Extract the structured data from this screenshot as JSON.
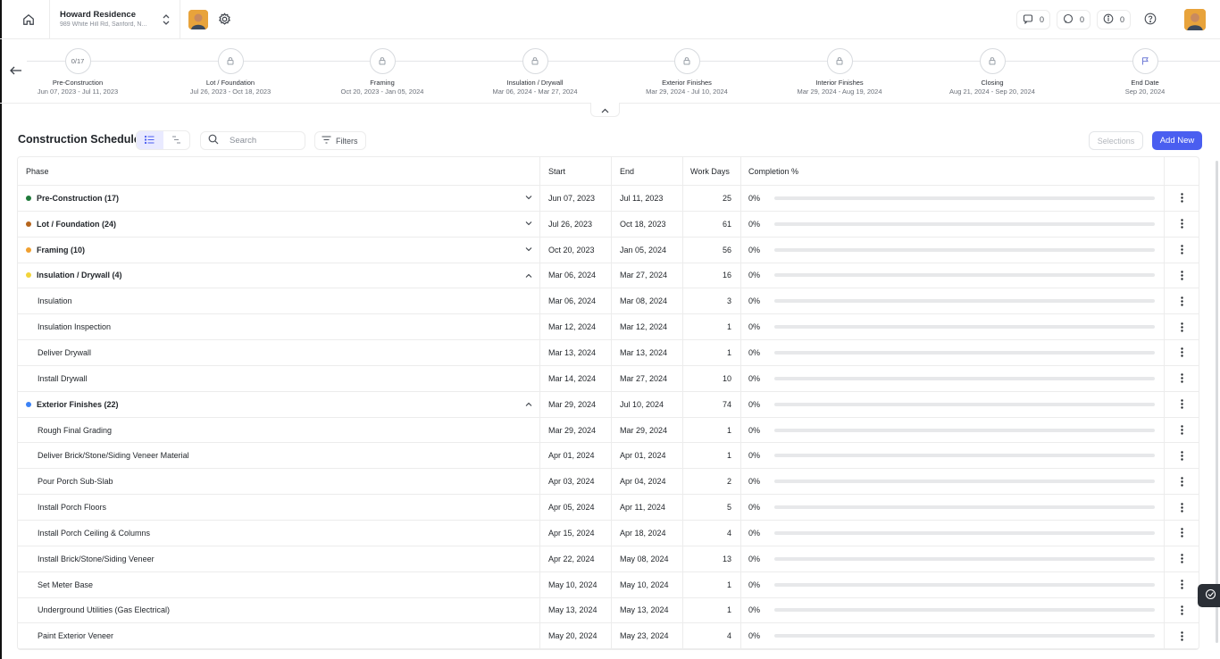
{
  "project": {
    "name": "Howard Residence",
    "address": "989 White Hill Rd, Sanford, N..."
  },
  "header": {
    "messages_count": "0",
    "comments_count": "0",
    "alerts_count": "0"
  },
  "timeline": {
    "steps": [
      {
        "circle": "0/17",
        "name": "Pre-Construction",
        "range": "Jun 07, 2023 - Jul 11, 2023",
        "icon": "progress-text"
      },
      {
        "circle": "",
        "name": "Lot / Foundation",
        "range": "Jul 26, 2023 - Oct 18, 2023",
        "icon": "lock-icon"
      },
      {
        "circle": "",
        "name": "Framing",
        "range": "Oct 20, 2023 - Jan 05, 2024",
        "icon": "lock-icon"
      },
      {
        "circle": "",
        "name": "Insulation / Drywall",
        "range": "Mar 06, 2024 - Mar 27, 2024",
        "icon": "lock-icon"
      },
      {
        "circle": "",
        "name": "Exterior Finishes",
        "range": "Mar 29, 2024 - Jul 10, 2024",
        "icon": "lock-icon"
      },
      {
        "circle": "",
        "name": "Interior Finishes",
        "range": "Mar 29, 2024 - Aug 19, 2024",
        "icon": "lock-icon"
      },
      {
        "circle": "",
        "name": "Closing",
        "range": "Aug 21, 2024 - Sep 20, 2024",
        "icon": "lock-icon"
      },
      {
        "circle": "",
        "name": "End Date",
        "range": "Sep 20, 2024",
        "icon": "flag-icon"
      }
    ]
  },
  "toolbar": {
    "title": "Construction Schedule",
    "search_placeholder": "Search",
    "filters_label": "Filters",
    "selections_label": "Selections",
    "add_new_label": "Add New"
  },
  "table": {
    "columns": {
      "phase": "Phase",
      "start": "Start",
      "end": "End",
      "days": "Work Days",
      "completion": "Completion %"
    },
    "rows": [
      {
        "type": "group",
        "phase": "Pre-Construction (17)",
        "dot": "#1f7a3a",
        "expanded": false,
        "start": "Jun 07, 2023",
        "end": "Jul 11, 2023",
        "days": "25",
        "completion": "0%",
        "progress": 0
      },
      {
        "type": "group",
        "phase": "Lot / Foundation (24)",
        "dot": "#b5651d",
        "expanded": false,
        "start": "Jul 26, 2023",
        "end": "Oct 18, 2023",
        "days": "61",
        "completion": "0%",
        "progress": 0
      },
      {
        "type": "group",
        "phase": "Framing (10)",
        "dot": "#f0a030",
        "expanded": false,
        "start": "Oct 20, 2023",
        "end": "Jan 05, 2024",
        "days": "56",
        "completion": "0%",
        "progress": 0
      },
      {
        "type": "group",
        "phase": "Insulation / Drywall (4)",
        "dot": "#f2d43a",
        "expanded": true,
        "start": "Mar 06, 2024",
        "end": "Mar 27, 2024",
        "days": "16",
        "completion": "0%",
        "progress": 0
      },
      {
        "type": "child",
        "phase": "Insulation",
        "start": "Mar 06, 2024",
        "end": "Mar 08, 2024",
        "days": "3",
        "completion": "0%",
        "progress": 0
      },
      {
        "type": "child",
        "phase": "Insulation Inspection",
        "start": "Mar 12, 2024",
        "end": "Mar 12, 2024",
        "days": "1",
        "completion": "0%",
        "progress": 0
      },
      {
        "type": "child",
        "phase": "Deliver Drywall",
        "start": "Mar 13, 2024",
        "end": "Mar 13, 2024",
        "days": "1",
        "completion": "0%",
        "progress": 0
      },
      {
        "type": "child",
        "phase": "Install Drywall",
        "start": "Mar 14, 2024",
        "end": "Mar 27, 2024",
        "days": "10",
        "completion": "0%",
        "progress": 0
      },
      {
        "type": "group",
        "phase": "Exterior Finishes (22)",
        "dot": "#3b82f6",
        "expanded": true,
        "start": "Mar 29, 2024",
        "end": "Jul 10, 2024",
        "days": "74",
        "completion": "0%",
        "progress": 0
      },
      {
        "type": "child",
        "phase": "Rough Final Grading",
        "start": "Mar 29, 2024",
        "end": "Mar 29, 2024",
        "days": "1",
        "completion": "0%",
        "progress": 0
      },
      {
        "type": "child",
        "phase": "Deliver Brick/Stone/Siding Veneer Material",
        "start": "Apr 01, 2024",
        "end": "Apr 01, 2024",
        "days": "1",
        "completion": "0%",
        "progress": 0
      },
      {
        "type": "child",
        "phase": "Pour Porch Sub-Slab",
        "start": "Apr 03, 2024",
        "end": "Apr 04, 2024",
        "days": "2",
        "completion": "0%",
        "progress": 0
      },
      {
        "type": "child",
        "phase": "Install Porch Floors",
        "start": "Apr 05, 2024",
        "end": "Apr 11, 2024",
        "days": "5",
        "completion": "0%",
        "progress": 0
      },
      {
        "type": "child",
        "phase": "Install Porch Ceiling & Columns",
        "start": "Apr 15, 2024",
        "end": "Apr 18, 2024",
        "days": "4",
        "completion": "0%",
        "progress": 0
      },
      {
        "type": "child",
        "phase": "Install Brick/Stone/Siding Veneer",
        "start": "Apr 22, 2024",
        "end": "May 08, 2024",
        "days": "13",
        "completion": "0%",
        "progress": 0
      },
      {
        "type": "child",
        "phase": "Set Meter Base",
        "start": "May 10, 2024",
        "end": "May 10, 2024",
        "days": "1",
        "completion": "0%",
        "progress": 0
      },
      {
        "type": "child",
        "phase": "Underground Utilities (Gas Electrical)",
        "start": "May 13, 2024",
        "end": "May 13, 2024",
        "days": "1",
        "completion": "0%",
        "progress": 0
      },
      {
        "type": "child",
        "phase": "Paint Exterior Veneer",
        "start": "May 20, 2024",
        "end": "May 23, 2024",
        "days": "4",
        "completion": "0%",
        "progress": 0
      }
    ]
  },
  "colors": {
    "accent": "#4a5ef0",
    "border": "#ececec"
  }
}
